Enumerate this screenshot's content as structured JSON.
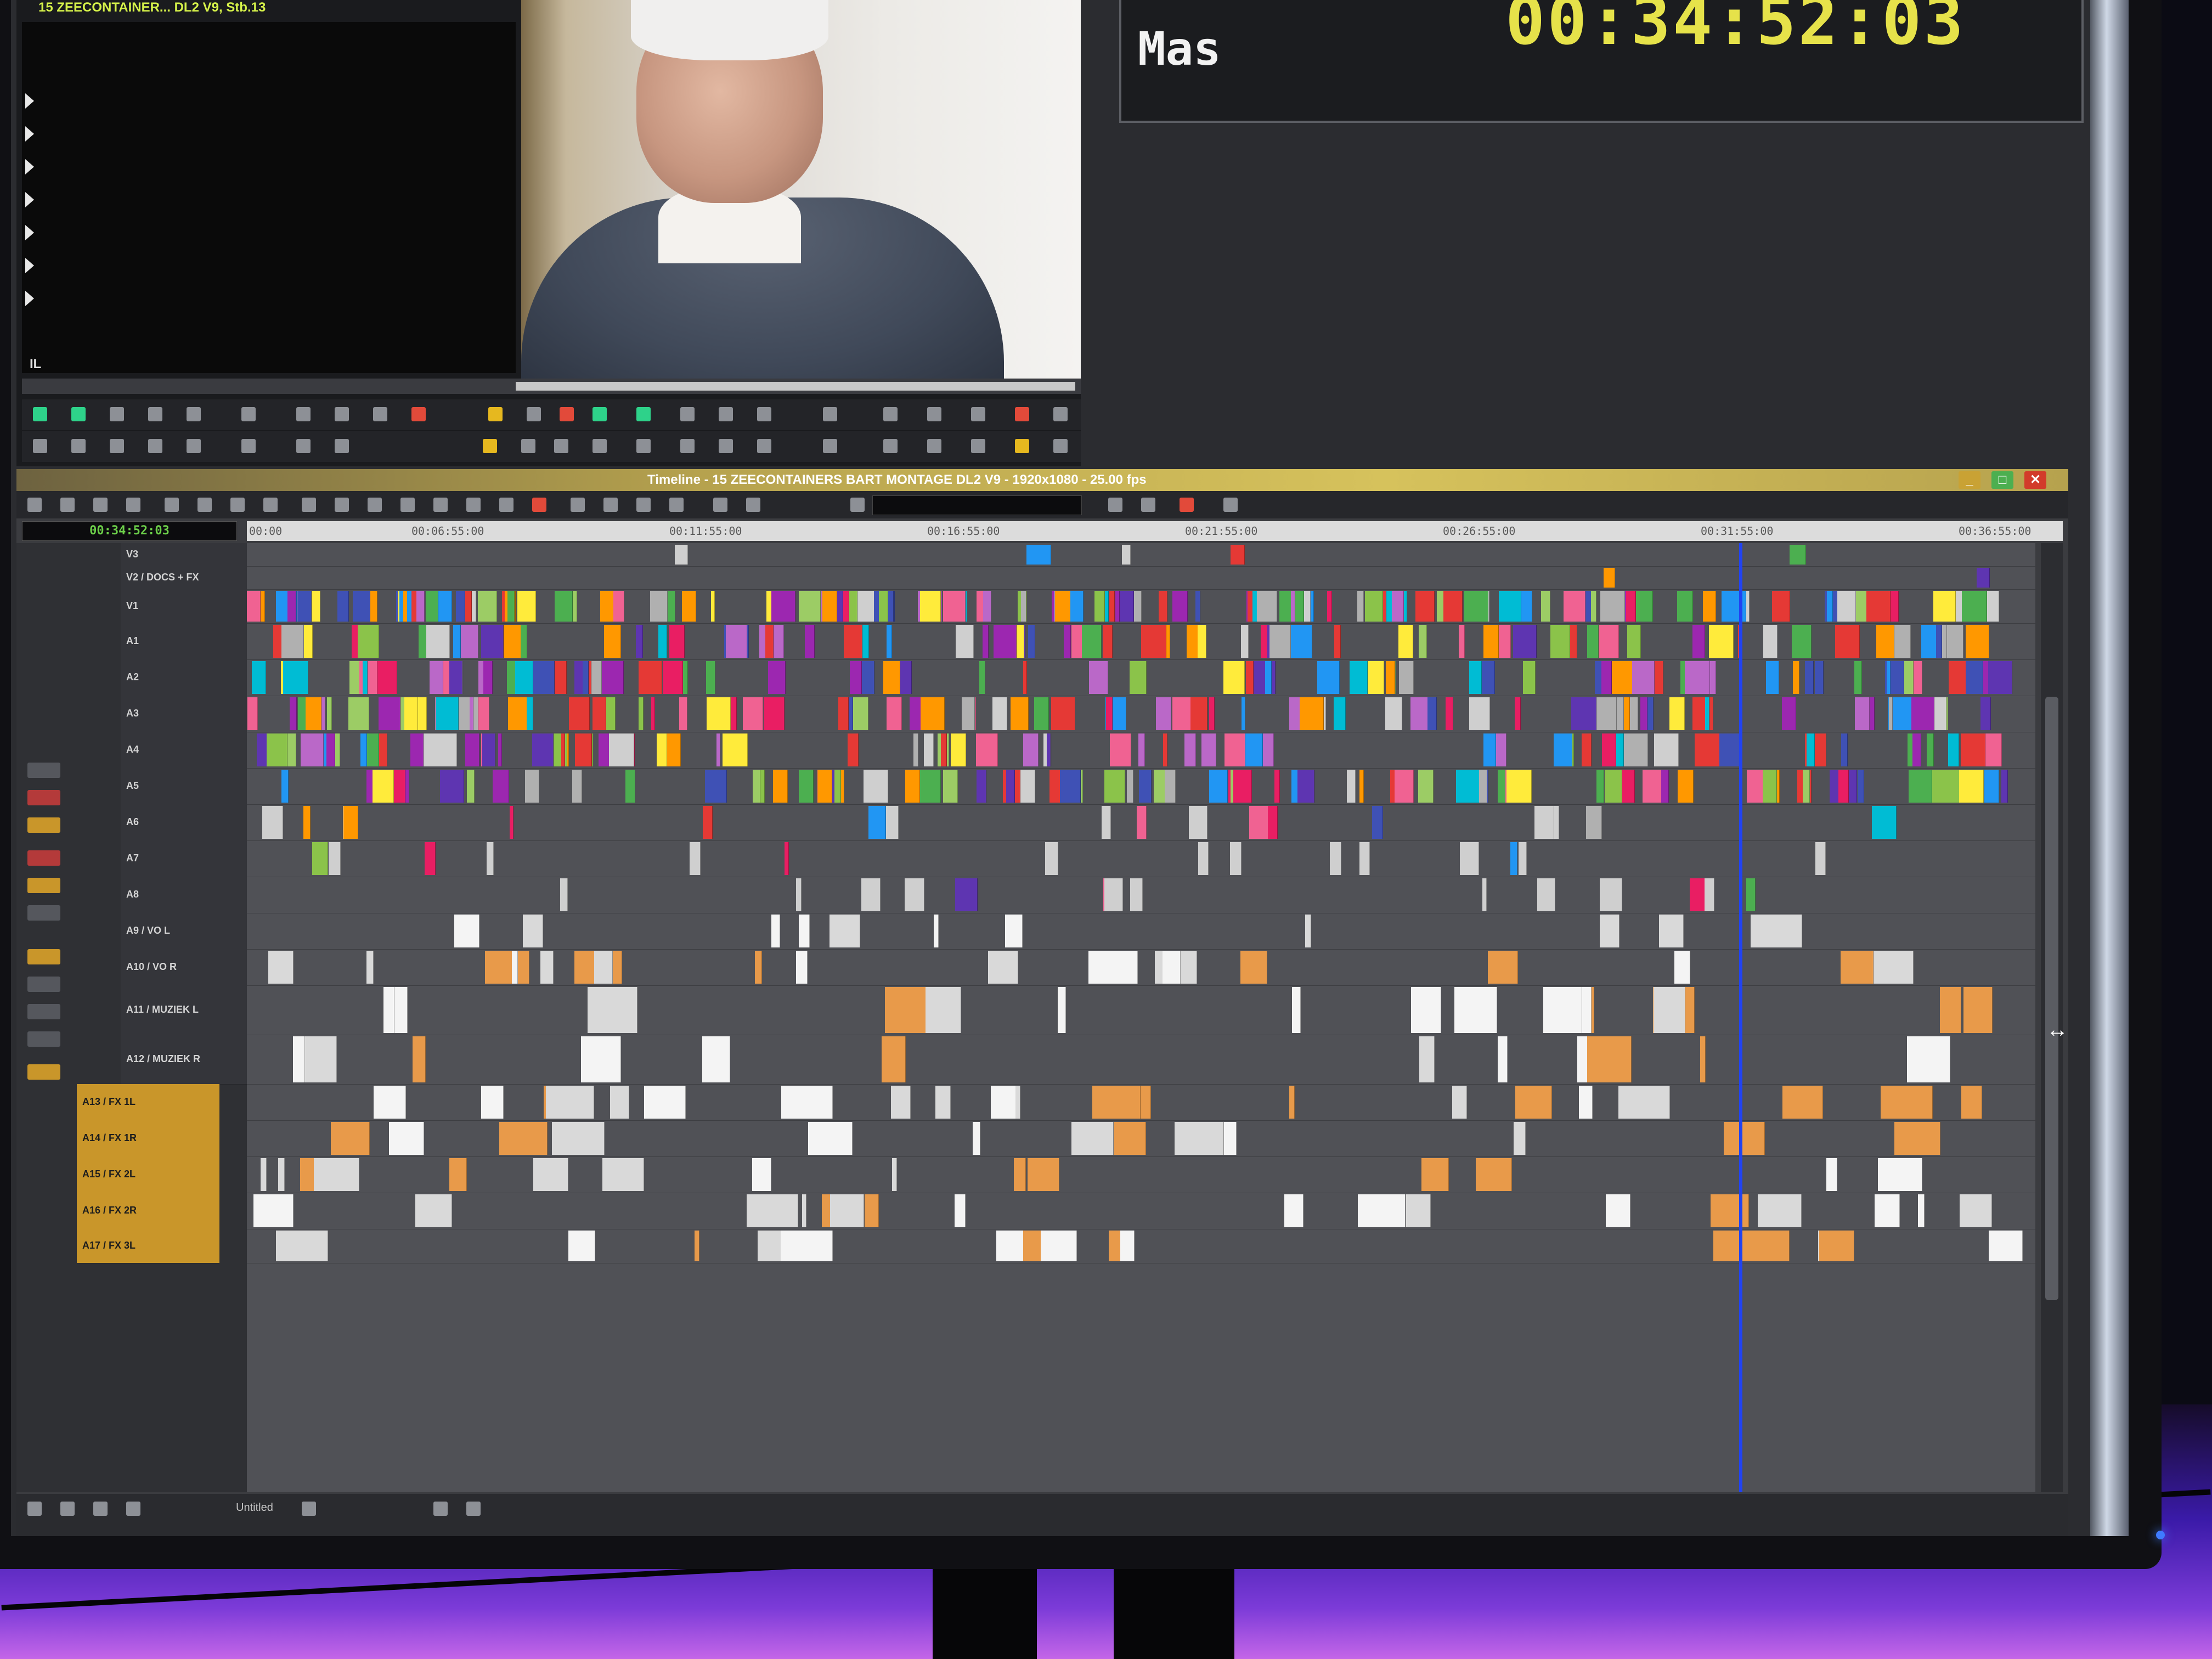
{
  "source_monitor": {
    "title": "15 ZEECONTAINER... DL2 V9, Stb.13",
    "viewer_label": "IL"
  },
  "timecode_display": {
    "label": "Mas",
    "value": "00:34:52:03"
  },
  "timeline": {
    "window_title": "Timeline - 15 ZEECONTAINERS BART MONTAGE DL2 V9 - 1920x1080 - 25.00 fps",
    "current_timecode": "00:34:52:03",
    "ruler_labels": [
      "00:00",
      "00:06:55:00",
      "00:11:55:00",
      "00:16:55:00",
      "00:21:55:00",
      "00:26:55:00",
      "00:31:55:00",
      "00:36:55:00"
    ],
    "tracks": [
      {
        "name": "V3",
        "patched": false
      },
      {
        "name": "V2 / DOCS + FX",
        "patched": false
      },
      {
        "name": "V1",
        "patched": false
      },
      {
        "name": "A1",
        "patched": false
      },
      {
        "name": "A2",
        "patched": false
      },
      {
        "name": "A3",
        "patched": false
      },
      {
        "name": "A4",
        "patched": false
      },
      {
        "name": "A5",
        "patched": false
      },
      {
        "name": "A6",
        "patched": false
      },
      {
        "name": "A7",
        "patched": false
      },
      {
        "name": "A8",
        "patched": false
      },
      {
        "name": "A9 / VO L",
        "patched": false
      },
      {
        "name": "A10 / VO R",
        "patched": false
      },
      {
        "name": "A11 / MUZIEK L",
        "patched": false
      },
      {
        "name": "A12 / MUZIEK R",
        "patched": false
      },
      {
        "name": "A13 / FX 1L",
        "patched": true
      },
      {
        "name": "A14 / FX 1R",
        "patched": true
      },
      {
        "name": "A15 / FX 2L",
        "patched": true
      },
      {
        "name": "A16 / FX 2R",
        "patched": true
      },
      {
        "name": "A17 / FX 3L",
        "patched": true
      }
    ],
    "bottom_label": "Untitled",
    "colors": {
      "playhead": "#2143f2",
      "titlebar": "#d6c25c",
      "patched_track": "#c9962a",
      "timecode_text": "#e6e24a"
    }
  },
  "window_buttons": {
    "minimize": "_",
    "maximize": "□",
    "close": "✕"
  }
}
